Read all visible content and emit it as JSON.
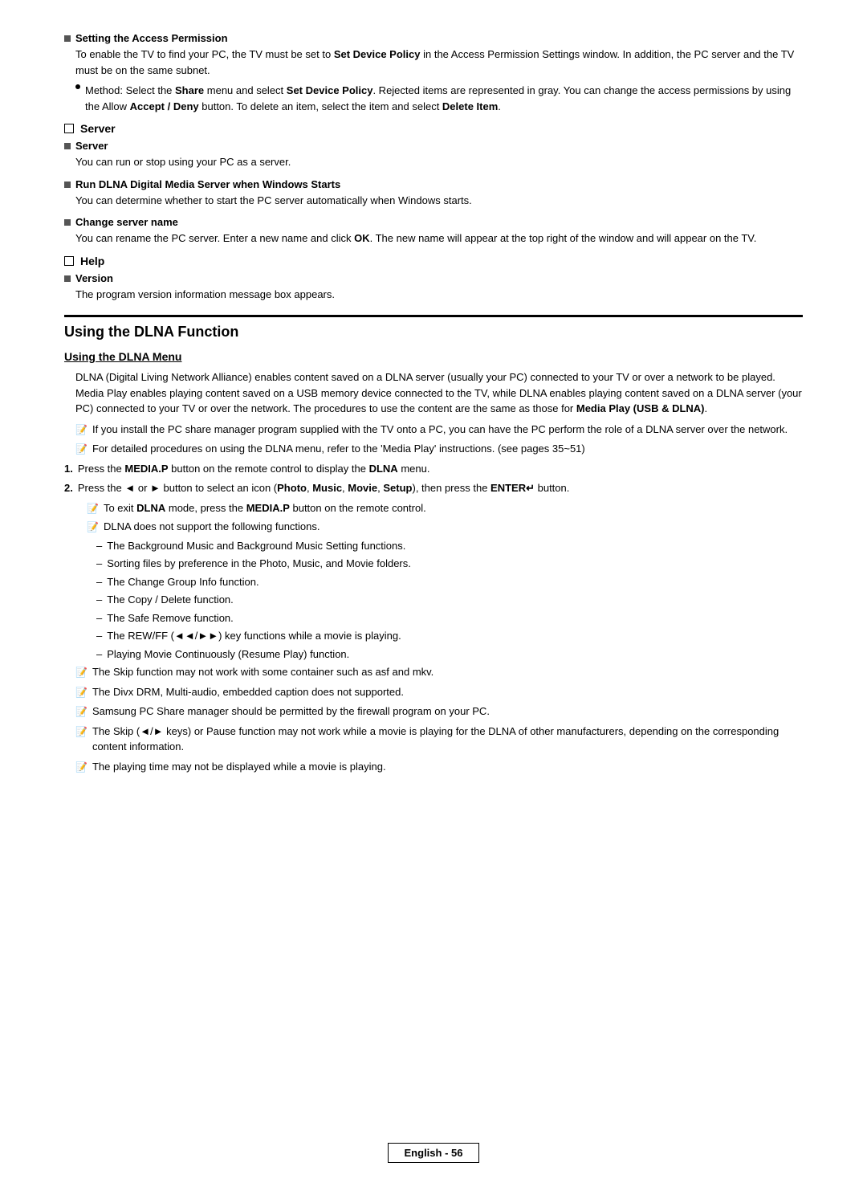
{
  "page": {
    "footer_text": "English - 56"
  },
  "sections": {
    "access_permission": {
      "heading": "Setting the Access Permission",
      "text1": "To enable the TV to find your PC, the TV must be set to Set Device Policy in the Access Permission Settings window. In addition, the PC server and the TV must be on the same subnet.",
      "bullet1": "Method: Select the Share menu and select Set Device Policy. Rejected items are represented in gray. You can change the access permissions by using the Allow Accept / Deny button. To delete an item, select the item and select Delete Item."
    },
    "server_heading": "Server",
    "server": {
      "heading": "Server",
      "text": "You can run or stop using your PC as a server."
    },
    "run_dlna": {
      "heading": "Run DLNA Digital Media Server when Windows Starts",
      "text": "You can determine whether to start the PC server automatically when Windows starts."
    },
    "change_server": {
      "heading": "Change server name",
      "text": "You can rename the PC server. Enter a new name and click OK. The new name will appear at the top right of the window and will appear on the TV."
    },
    "help_heading": "Help",
    "version": {
      "heading": "Version",
      "text": "The program version information message box appears."
    },
    "using_dlna": {
      "title": "Using the DLNA Function",
      "menu_title": "Using the DLNA Menu",
      "intro": "DLNA (Digital Living Network Alliance) enables content saved on a DLNA server (usually your PC) connected to your TV or over a network to be played. Media Play enables playing content saved on a USB memory device connected to the TV, while DLNA enables playing content saved on a DLNA server (your PC) connected to your TV or over the network. The procedures to use the content are the same as those for Media Play (USB & DLNA).",
      "note1": "If you install the PC share manager program supplied with the TV onto a PC, you can have the PC perform the role of a DLNA server over the network.",
      "note2": "For detailed procedures on using the DLNA menu, refer to the 'Media Play' instructions. (see pages 35~51)",
      "step1": "Press the MEDIA.P button on the remote control to display the DLNA menu.",
      "step2": "Press the ◄ or ► button to select an icon (Photo, Music, Movie, Setup), then press the ENTER↵ button.",
      "sub_note1": "To exit DLNA mode, press the MEDIA.P button on the remote control.",
      "sub_note2": "DLNA does not support the following functions.",
      "dash1": "The Background Music and Background Music Setting functions.",
      "dash2": "Sorting files by preference in the Photo, Music, and Movie folders.",
      "dash3": "The Change Group Info function.",
      "dash4": "The Copy / Delete function.",
      "dash5": "The Safe Remove function.",
      "dash6": "The REW/FF (◄◄/►►) key functions while a movie is playing.",
      "dash7": "Playing Movie Continuously (Resume Play) function.",
      "note3": "The Skip function may not work with some container such as asf and mkv.",
      "note4": "The Divx DRM, Multi-audio, embedded caption does not supported.",
      "note5": "Samsung PC Share manager should be permitted by the firewall program on your PC.",
      "note6": "The Skip (◄/► keys) or Pause function may not work while a movie is playing for the DLNA of other manufacturers, depending on the corresponding content information.",
      "note7": "The playing time may not be displayed while a movie is playing."
    }
  }
}
